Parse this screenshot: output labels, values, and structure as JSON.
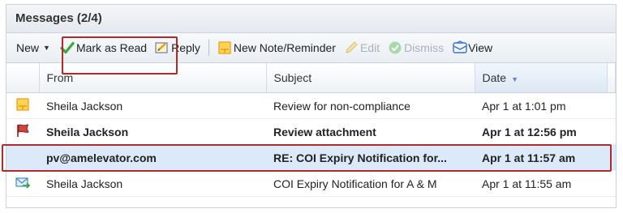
{
  "panel": {
    "title": "Messages (2/4)"
  },
  "toolbar": {
    "new_label": "New",
    "mark_read_label": "Mark as Read",
    "reply_label": "Reply",
    "new_note_label": "New Note/Reminder",
    "edit_label": "Edit",
    "dismiss_label": "Dismiss",
    "view_label": "View"
  },
  "columns": {
    "from": "From",
    "subject": "Subject",
    "date": "Date"
  },
  "rows": [
    {
      "icon": "note-icon",
      "from": "Sheila Jackson",
      "subject": "Review for non-compliance",
      "date": "Apr 1 at 1:01 pm"
    },
    {
      "icon": "flag-icon",
      "from": "Sheila Jackson",
      "subject": "Review attachment",
      "date": "Apr 1 at 12:56 pm"
    },
    {
      "icon": "",
      "from": "pv@amelevator.com",
      "subject": "RE: COI Expiry Notification for...",
      "date": "Apr 1 at 11:57 am"
    },
    {
      "icon": "envelope-forward-icon",
      "from": "Sheila Jackson",
      "subject": "COI Expiry Notification for A & M",
      "date": "Apr 1 at 11:55 am"
    }
  ],
  "colors": {
    "highlight_border": "#b02a2a",
    "selected_row": "#dce9f8",
    "check_green": "#3aa83a"
  }
}
